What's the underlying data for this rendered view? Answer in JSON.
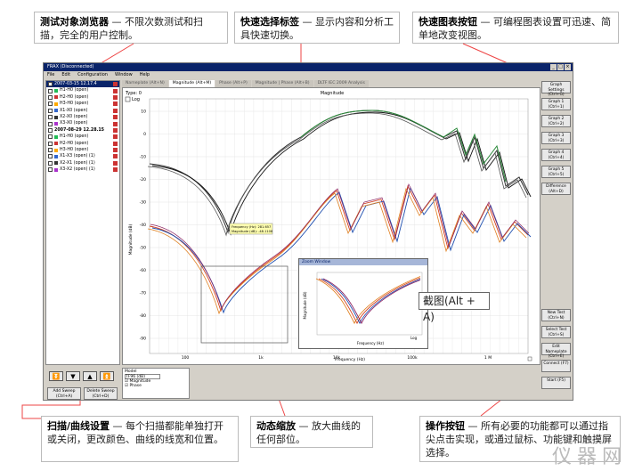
{
  "callouts": {
    "browser": {
      "title": "测试对象浏览器",
      "text": " — 不限次数测试和扫描，完全的用户控制。"
    },
    "tabs": {
      "title": "快速选择标签",
      "text": " — 显示内容和分析工具快速切换。"
    },
    "graphbtn": {
      "title": "快速图表按钮",
      "text": " — 可编程图表设置可迅速、简单地改变视图。"
    },
    "sweep": {
      "title": "扫描/曲线设置",
      "text": " — 每个扫描都能单独打开或关闭，更改颜色、曲线的线宽和位置。"
    },
    "zoom": {
      "title": "动态缩放",
      "text": " — 放大曲线的任何部位。"
    },
    "actions": {
      "title": "操作按钮",
      "text": " — 所有必要的功能都可以通过指尖点击实现，或通过鼠标、功能键和触摸屏选择。"
    }
  },
  "app": {
    "title": "FRAX (Disconnected)",
    "menu": [
      "File",
      "Edit",
      "Configuration",
      "Window",
      "Help"
    ]
  },
  "tabs": [
    "Nameplate (Alt+N)",
    "Magnitude (Alt+M)",
    "Phase (Alt+P)",
    "Magnitude | Phase (Alt+B)",
    "DLTF IEC 2009 Analysis"
  ],
  "tree": [
    {
      "label": "2007-03-15 12.17.4",
      "kind": "header"
    },
    {
      "label": "H1-H0 (open)",
      "color": "#2b5"
    },
    {
      "label": "H2-H0 (open)",
      "color": "#c33"
    },
    {
      "label": "H3-H0 (open)",
      "color": "#fa0"
    },
    {
      "label": "X1-X0 (open)",
      "color": "#36c"
    },
    {
      "label": "X2-X0 (open)",
      "color": "#333"
    },
    {
      "label": "X3-X0 (open)",
      "color": "#a3c"
    },
    {
      "label": "2007-08-29 12.28.15",
      "kind": "hdr2"
    },
    {
      "label": "H1-H0 (open)",
      "color": "#2b5"
    },
    {
      "label": "H2-H0 (open)",
      "color": "#c33"
    },
    {
      "label": "H3-H0 (open)",
      "color": "#fa0"
    },
    {
      "label": "X1-X3 (open) (1)",
      "color": "#36c"
    },
    {
      "label": "X2-X1 (open) (1)",
      "color": "#333"
    },
    {
      "label": "X3-X2 (open) (1)",
      "color": "#a3c"
    }
  ],
  "sweep_buttons": {
    "add": "Add Sweep (Ctrl+A)",
    "delete": "Delete Sweep (Ctrl+D)"
  },
  "plot": {
    "title": "Magnitude",
    "type_label": "Type: 0",
    "log_label": "Log",
    "ylabel": "Magnitude (dB)",
    "xlabel": "Frequency (Hz)",
    "yticks": [
      "10",
      "0",
      "-10",
      "-20",
      "-30",
      "-40",
      "-50",
      "-60",
      "-70",
      "-80",
      "-90"
    ],
    "xticks": [
      "100",
      "1k",
      "10k",
      "100k",
      "1 M"
    ],
    "tooltip": [
      "Frequency (Hz): 281.657",
      "Magnitude (dB): -48.1108"
    ]
  },
  "right_buttons": [
    "Graph Settings (Ctrl+G)",
    "Graph 1 (Ctrl+1)",
    "Graph 2 (Ctrl+2)",
    "Graph 3 (Ctrl+3)",
    "Graph 4 (Ctrl+4)",
    "Graph 5 (Ctrl+5)",
    "Difference (Alt+D)",
    "New Test (Ctrl+N)",
    "Select Test (Ctrl+S)",
    "Edit Nameplate (Ctrl+E)",
    "Connect (F7)",
    "Start (F5)"
  ],
  "model": {
    "title": "Model",
    "select": "TF96 (dB)",
    "items": [
      "Magnitude",
      "Phase"
    ]
  },
  "zoom": {
    "title": "Zoom Window",
    "caption": "截图(Alt + A)",
    "xlabel": "Frequency (Hz)",
    "ylabel": "Magnitude (dB)",
    "log": "Log"
  },
  "watermark": "仪器网"
}
